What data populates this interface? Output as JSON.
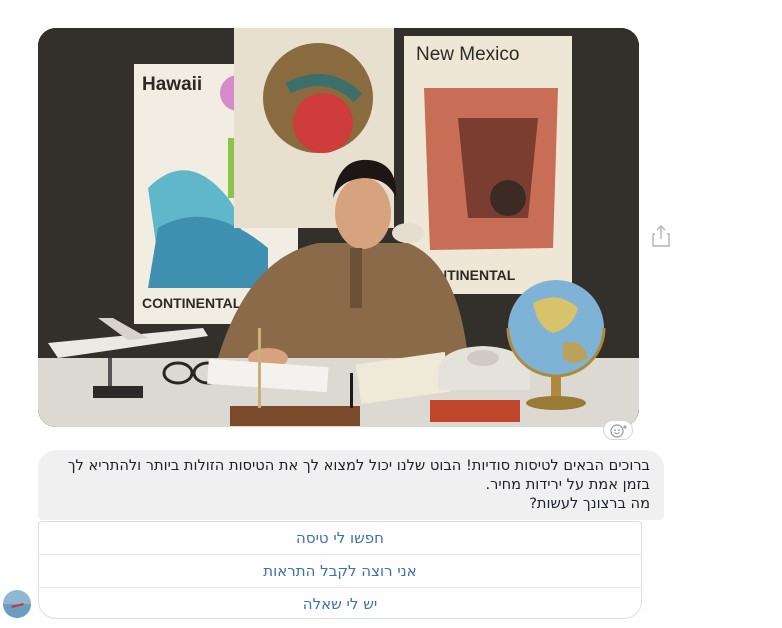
{
  "image": {
    "subject": "vintage-travel-agent-photo",
    "posters": [
      "Hawaii",
      "New Mexico",
      "CONTINENTAL",
      "CONTINENTAL"
    ]
  },
  "message": {
    "lines": [
      "ברוכים הבאים לטיסות סודיות! הבוט שלנו יכול למצוא לך את הטיסות הזולות ביותר ולהתריא לך",
      "בזמן אמת על ירידות מחיר.",
      "מה ברצונך לעשות?"
    ]
  },
  "quick_replies": [
    {
      "label": "חפשו לי טיסה"
    },
    {
      "label": "אני רוצה לקבל התראות"
    },
    {
      "label": "יש לי שאלה"
    }
  ],
  "icons": {
    "share": "share-icon",
    "reaction": "smiley-add-icon",
    "avatar": "bot-avatar"
  },
  "colors": {
    "bubble_bg": "#f1f0f0",
    "quick_reply_text": "#3b6fb6",
    "border": "#dcdee2"
  }
}
